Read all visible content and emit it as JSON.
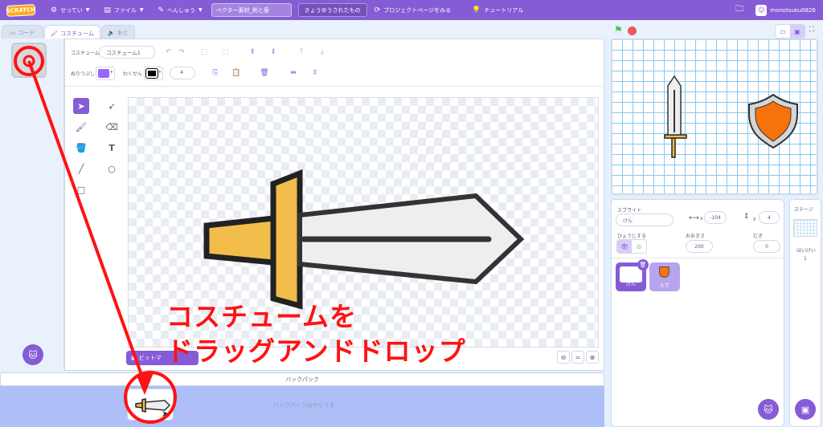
{
  "menubar": {
    "logo": "SCRATCH",
    "settings": "せってい",
    "file": "ファイル",
    "edit": "へんしゅう",
    "project_title": "ベクター素材_剣と盾",
    "saved": "きょうゆうされたもの",
    "project_page": "プロジェクトページをみる",
    "tutorial": "チュートリアル",
    "username": "monotsuku0826"
  },
  "tabs": {
    "code": "コード",
    "costume": "コスチューム",
    "sound": "おと"
  },
  "editor": {
    "costume_label": "コスチューム",
    "costume_name": "コスチューム1",
    "fill_label": "ぬりつぶし",
    "outline_label": "わくせん",
    "outline_width": "4",
    "bitmap_button": "ビットマ",
    "fill_color": "#9966ff",
    "outline_color": "#000000"
  },
  "backpack": {
    "title": "バックパック",
    "empty": "バックパックはからです"
  },
  "sprite_panel": {
    "label": "スプライト",
    "name": "けん",
    "x_label": "x",
    "x": "-104",
    "y_label": "y",
    "y": "4",
    "show_label": "ひょうじする",
    "size_label": "おおきさ",
    "size": "200",
    "direction_label": "むき",
    "direction": "0",
    "sprites": [
      {
        "name": "けん"
      },
      {
        "name": "たて"
      }
    ]
  },
  "stage_panel": {
    "label": "ステージ",
    "backdrops_label": "はいけい",
    "backdrops_count": "1"
  },
  "annotation": {
    "line1": "コスチュームを",
    "line2": "ドラッグアンドドロップ",
    "color": "#ff1212"
  },
  "colors": {
    "accent": "#855cd6",
    "sword_guard": "#f2bd4b",
    "sword_blade": "#eeeeee",
    "shield": "#f5720d"
  }
}
